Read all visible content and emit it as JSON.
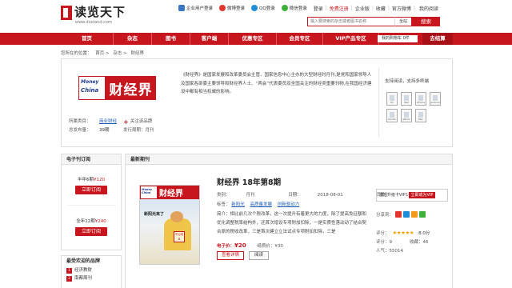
{
  "header": {
    "logo_text": "读览天下",
    "logo_sub": "www.dooland.com",
    "top_links": [
      {
        "label": "企业用户登录",
        "icon": "enterprise-icon"
      },
      {
        "label": "微博登录",
        "icon": "weibo-icon"
      },
      {
        "label": "QQ登录",
        "icon": "qq-icon"
      },
      {
        "label": "微信登录",
        "icon": "wechat-icon"
      }
    ],
    "login": "登录",
    "register": "免费注册",
    "enterprise_space": "企业版",
    "favorites": "收藏",
    "official_weibo": "官方微博",
    "my_reading": "我的阅读",
    "search": {
      "placeholder": "输入要搜索的杂志或者图书名称",
      "scope": "全站",
      "button": "搜索"
    }
  },
  "nav": {
    "items": [
      "首页",
      "杂志",
      "图书",
      "客户端",
      "优惠专区",
      "会员专区",
      "VIP产品专区"
    ],
    "cart": "我的购物车 0件",
    "checkout": "去结算"
  },
  "breadcrumb": {
    "prefix": "您所在的位置：",
    "items": [
      "首页",
      "杂志",
      "财经界"
    ]
  },
  "brand": {
    "logo_en1": "Money",
    "logo_en2": "China",
    "logo_cn": "财经界",
    "category_label": "所属类目：",
    "category_value": "商业财经",
    "follow": "关注该品牌",
    "volume_label": "总发布量：",
    "volume_value": "39期",
    "cycle_label": "发行周期：",
    "cycle_value": "月刊",
    "description": "《财经界》是国家发展和改革委员会主管、国家信息中心主办的大型财经时月刊,是党和国家领导人及国家各部委主要领导和财经界人士、“两会”代表委员及全国关注的财经类重要刊物,在我国经济建设中都有相当权威的影响。",
    "devices_title": "支持阅读，支持多终端",
    "devices": [
      "PC",
      "iPad",
      "iPhone",
      "Android",
      "Kindle",
      "eBook",
      "Mac"
    ]
  },
  "sidebar": {
    "subscribe_title": "电子刊订阅",
    "half_year_label": "半年6期",
    "half_year_price": "¥120",
    "full_year_label": "全年12期",
    "full_year_price": "¥240",
    "subscribe_button": "立即订阅",
    "rank_title": "最受欢迎的品牌",
    "rank_items": [
      "经济教财",
      "南都周刊"
    ]
  },
  "issue": {
    "section_title": "最新期刊",
    "cover_heading": "新阳光来了",
    "cover_sign": "不出成本",
    "title": "财经界 18年第8期",
    "type_label": "类别：",
    "type_value": "月刊",
    "date_label": "日期：",
    "date_value": "2018-08-01",
    "pages_label": "页数：",
    "pages_value": "144",
    "tags_label": "标签：",
    "tags": [
      "新阳光",
      "高质量发展",
      "创新驱动力"
    ],
    "summary": "简介：相比前几次个税改革，这一次提升有着更大的力度，除了提高免征额和优化调整税率结构外，还首次增设专项附加扣除，一是实质性落动动了结合契合原的税收改革，三是首次建立立法试点专项附加扣除，三是",
    "ebook_label": "电子价：",
    "ebook_price": "¥20",
    "paper_label": "纸质价：",
    "paper_price": "¥30",
    "details_button": "查看详情",
    "read_button": "阅读",
    "vip_text": "激活升级卡VIP",
    "vip_button": "立即成为VIP",
    "share_label": "分享到：",
    "rating_label": "评分：",
    "stars": "★★★★★",
    "score": "8.0分",
    "ratings_count_label": "评分：",
    "ratings_count": "9",
    "buyers_label": "收藏：",
    "buyers_count": "46",
    "popularity_label": "人气：",
    "popularity_value": "55014"
  },
  "colors": {
    "brand_red": "#c8161e",
    "link_blue": "#1d5bb4",
    "star_orange": "#f3a200"
  }
}
